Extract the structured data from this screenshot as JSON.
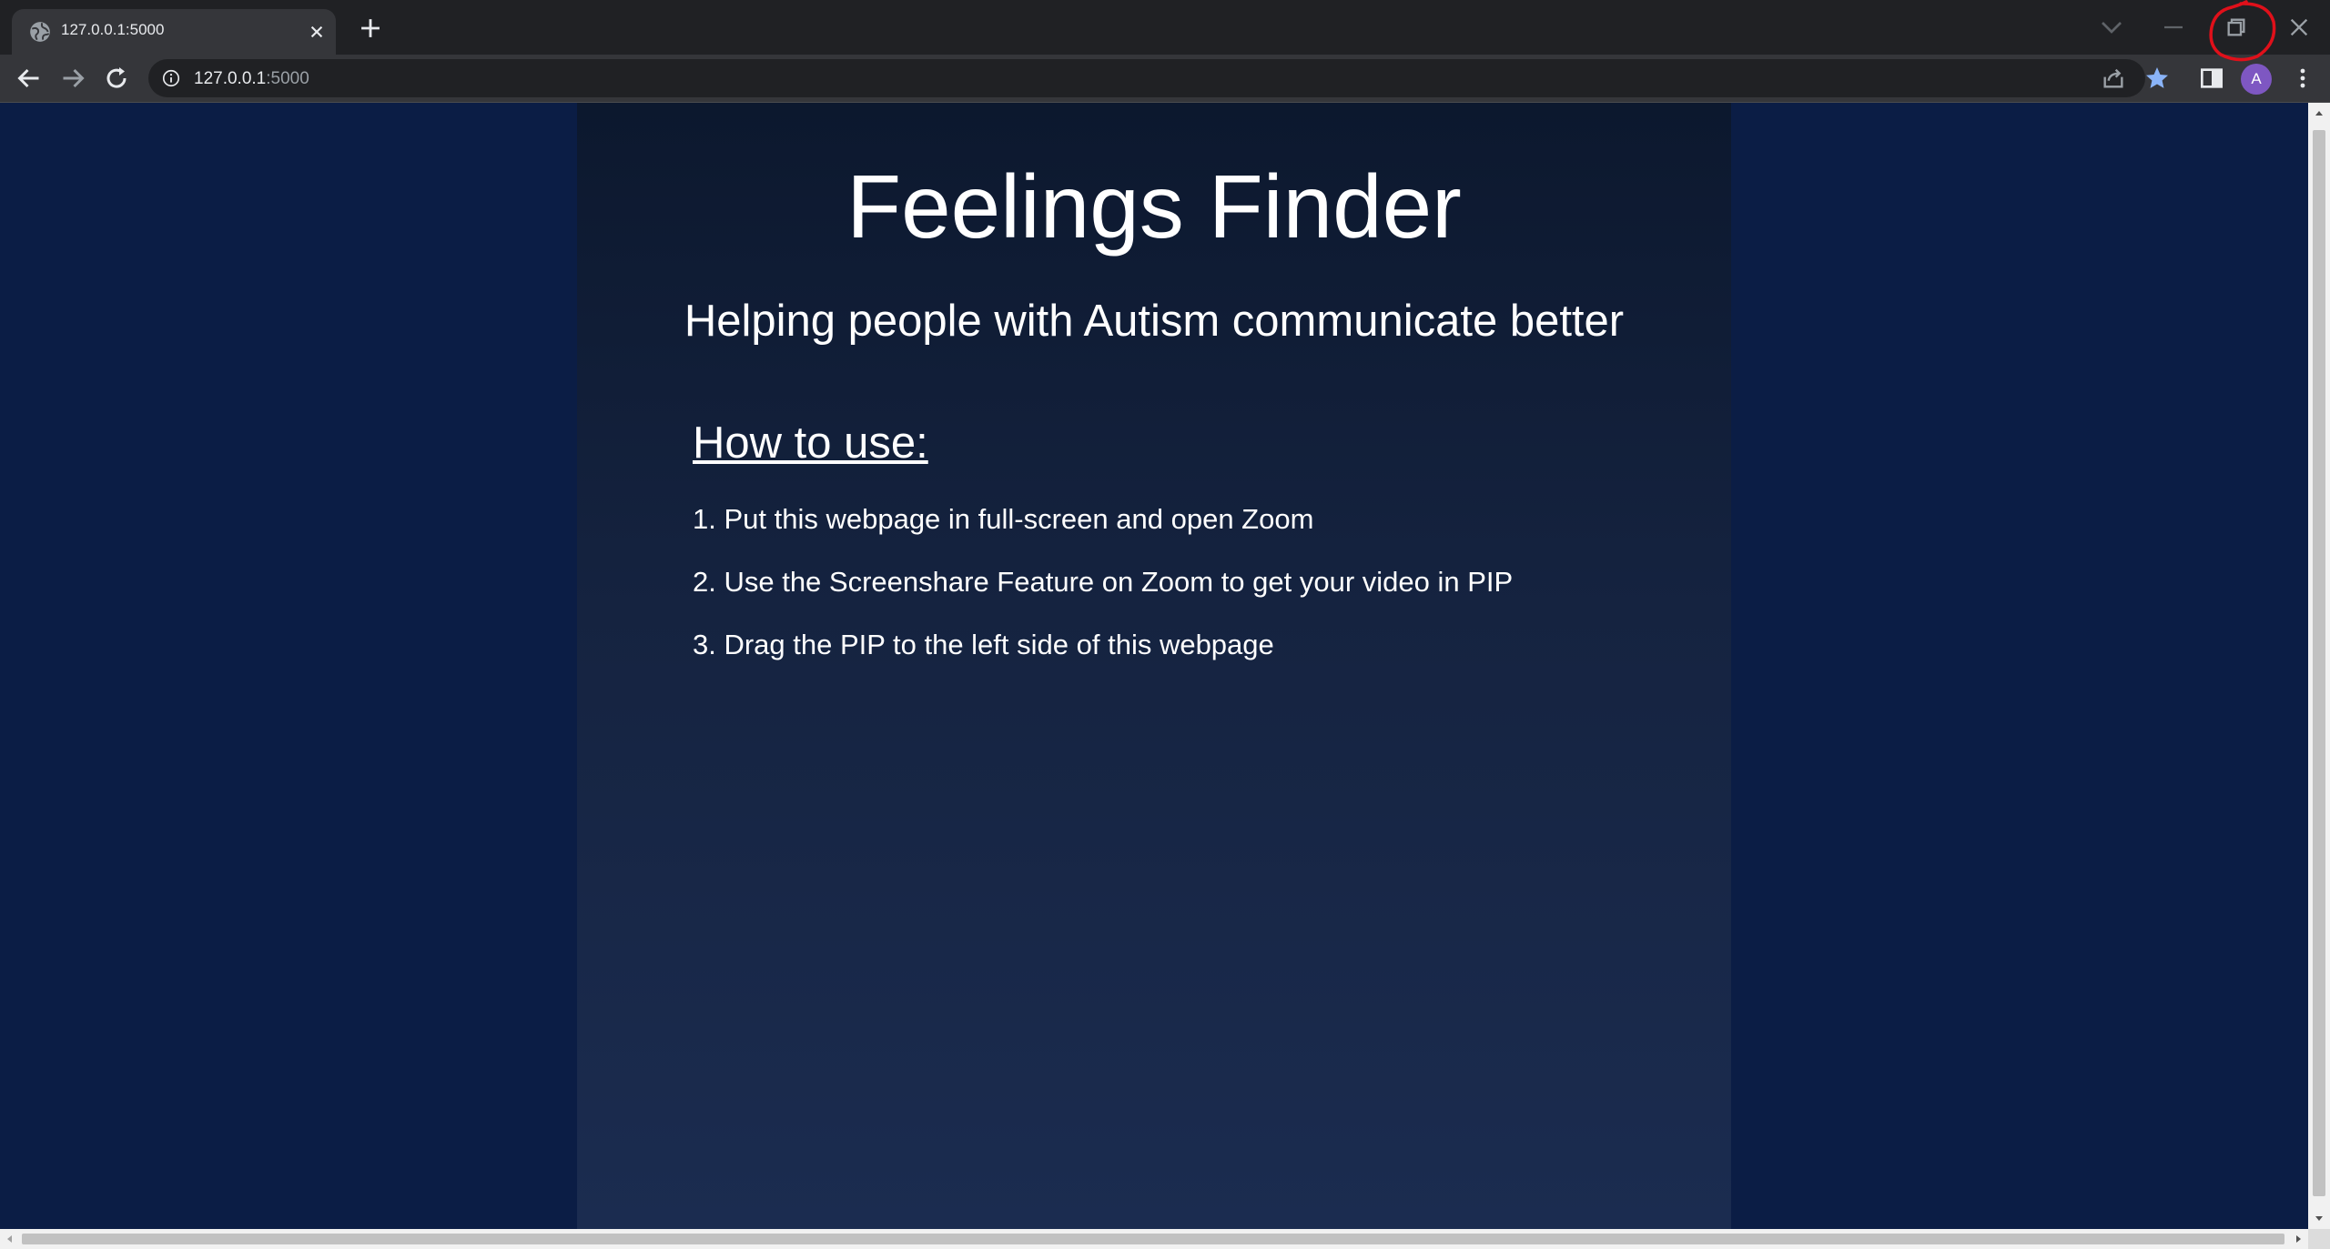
{
  "browser": {
    "tab": {
      "title": "127.0.0.1:5000",
      "favicon": "globe-icon",
      "close_icon": "close-icon"
    },
    "new_tab_icon": "plus-icon",
    "window_controls": [
      "tab-search-icon",
      "minimize-icon",
      "restore-icon",
      "close-icon"
    ],
    "toolbar": {
      "back_icon": "back-arrow-icon",
      "forward_icon": "forward-arrow-icon",
      "reload_icon": "reload-icon",
      "site_info_icon": "info-icon",
      "url_host": "127.0.0.1",
      "url_port": ":5000",
      "share_icon": "share-icon",
      "bookmark_icon": "star-icon",
      "side_panel_icon": "side-panel-icon",
      "avatar_initial": "A",
      "menu_icon": "kebab-menu-icon"
    }
  },
  "page": {
    "title": "Feelings Finder",
    "subtitle": "Helping people with Autism communicate better",
    "howto_heading": "How to use:",
    "steps": [
      "1. Put this webpage in full-screen and open Zoom",
      "2. Use the Screenshare Feature on Zoom to get your video in PIP",
      "3. Drag the PIP to the left side of this webpage"
    ]
  },
  "annotation": {
    "type": "red-circle",
    "target": "restore-icon",
    "color": "#e0101a"
  },
  "colors": {
    "page_background": "#0b1d45",
    "panel_top": "#0c182e",
    "panel_bottom": "#1b2c50",
    "chrome_dark": "#202124",
    "chrome_toolbar": "#35363a",
    "bookmark_star": "#8ab4f8",
    "avatar": "#7e57c2"
  }
}
